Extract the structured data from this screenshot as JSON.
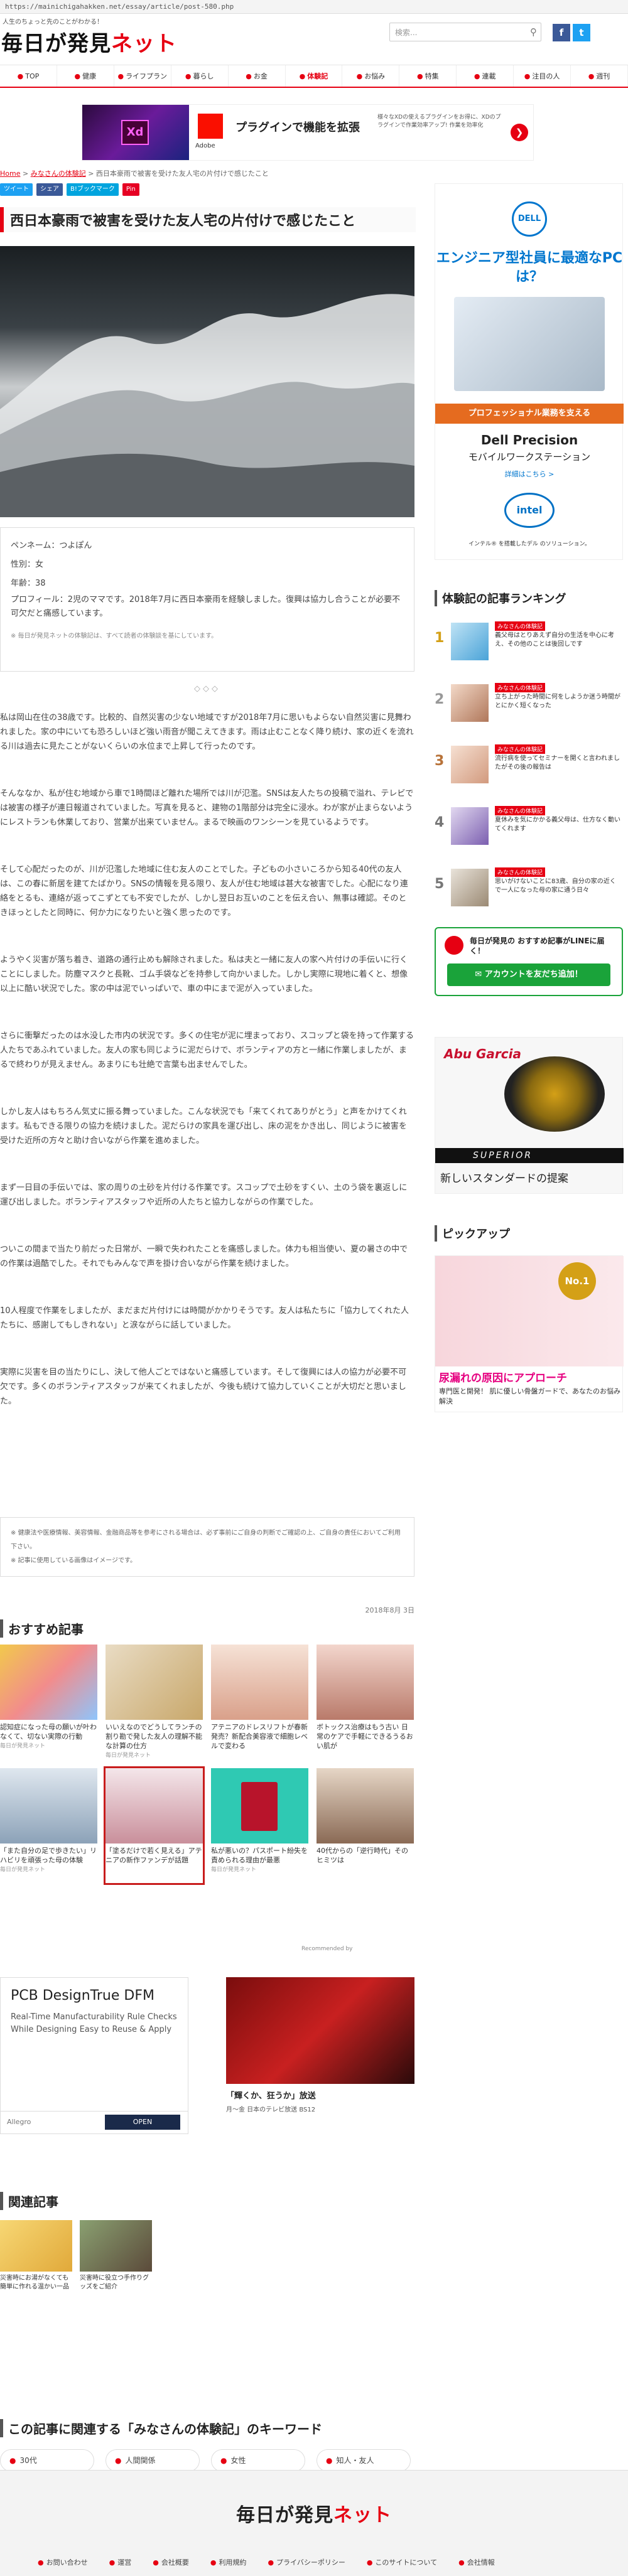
{
  "browser": {
    "url": "https://mainichigahakken.net/essay/article/post-580.php"
  },
  "header": {
    "tagline": "人生のちょっと先のことがわかる！",
    "logo_main": "毎日が発見",
    "logo_accent": "ネット",
    "search_placeholder": "検索...",
    "sns": [
      "f",
      "t"
    ]
  },
  "nav": {
    "items": [
      "TOP",
      "健康",
      "ライフプラン",
      "暮らし",
      "お金",
      "体験記",
      "お悩み",
      "特集",
      "連載",
      "注目の人",
      "週刊"
    ],
    "active_index": 5
  },
  "top_ad": {
    "brand": "Adobe",
    "headline": "プラグインで機能を拡張",
    "desc": "様々なXDの使えるプラグインをお得に、XDのプラグインで作業効率アップ!  作業を効率化",
    "tile": "Xd"
  },
  "breadcrumb": {
    "home": "Home",
    "section": "みなさんの体験記",
    "current": "西日本豪雨で被害を受けた友人宅の片付けで感じたこと"
  },
  "share": {
    "buttons": [
      "ツイート",
      "シェア",
      "B!ブックマーク",
      "Pin"
    ]
  },
  "article": {
    "title": "西日本豪雨で被害を受けた友人宅の片付けで感じたこと",
    "profile": {
      "name": "ペンネーム：つよぽん",
      "gender": "性別：女",
      "age": "年齢：38",
      "bio": "プロフィール：2児のママです。2018年7月に西日本豪雨を経験しました。復興は協力し合うことが必要不可欠だと痛感しています。",
      "note": "※ 毎日が発見ネットの体験記は、すべて読者の体験談を基にしています。"
    },
    "ornament": "◇◇◇",
    "paragraphs": [
      "私は岡山在住の38歳です。比較的、自然災害の少ない地域ですが2018年7月に思いもよらない自然災害に見舞われました。家の中にいても恐ろしいほど強い雨音が聞こえてきます。雨は止むことなく降り続け、家の近くを流れる川は過去に見たことがないくらいの水位まで上昇して行ったのです。",
      "そんななか、私が住む地域から車で1時間ほど離れた場所では川が氾濫。SNSは友人たちの投稿で溢れ、テレビでは被害の様子が連日報道されていました。写真を見ると、建物の1階部分は完全に浸水。わが家が止まらないようにレストランも休業しており、営業が出来ていません。まるで映画のワンシーンを見ているようです。",
      "そして心配だったのが、川が氾濫した地域に住む友人のことでした。子どもの小さいころから知る40代の友人は、この春に新居を建てたばかり。SNSの情報を見る限り、友人が住む地域は甚大な被害でした。心配になり連絡をとるも、連絡が返ってこずとても不安でしたが、しかし翌日お互いのことを伝え合い、無事は確認。そのときほっとしたと同時に、何か力になりたいと強く思ったのです。",
      "ようやく災害が落ち着き、道路の通行止めも解除されました。私は夫と一緒に友人の家へ片付けの手伝いに行くことにしました。防塵マスクと長靴、ゴム手袋などを持参して向かいました。しかし実際に現地に着くと、想像以上に酷い状況でした。家の中は泥でいっぱいで、車の中にまで泥が入っていました。",
      "さらに衝撃だったのは水没した市内の状況です。多くの住宅が泥に埋まっており、スコップと袋を持って作業する人たちであふれていました。友人の家も同じように泥だらけで、ボランティアの方と一緒に作業しましたが、まるで終わりが見えません。あまりにも壮絶で言葉も出ませんでした。",
      "しかし友人はもちろん気丈に振る舞っていました。こんな状況でも「来てくれてありがとう」と声をかけてくれます。私もできる限りの協力を続けました。泥だらけの家具を運び出し、床の泥をかき出し、同じように被害を受けた近所の方々と助け合いながら作業を進めました。",
      "まず一日目の手伝いでは、家の周りの土砂を片付ける作業です。スコップで土砂をすくい、土のう袋を裏返しに運び出しました。ボランティアスタッフや近所の人たちと協力しながらの作業でした。",
      "ついこの間まで当たり前だった日常が、一瞬で失われたことを痛感しました。体力も相当使い、夏の暑さの中での作業は過酷でした。それでもみんなで声を掛け合いながら作業を続けました。",
      "10人程度で作業をしましたが、まだまだ片付けには時間がかかりそうです。友人は私たちに「協力してくれた人たちに、感謝してもしきれない」と涙ながらに話していました。",
      "実際に災害を目の当たりにし、決して他人ごとではないと痛感しています。そして復興には人の協力が必要不可欠です。多くのボランティアスタッフが来てくれましたが、今後も続けて協力していくことが大切だと思いました。"
    ],
    "disclaimer": [
      "※ 健康法や医療情報、美容情報、金融商品等を参考にされる場合は、必ず事前にご自身の判断でご確認の上、ご自身の責任においてご利用下さい。",
      "※ 記事に使用している画像はイメージです。"
    ],
    "date": "2018年8月 3日"
  },
  "recommend": {
    "title": "おすすめ記事",
    "items": [
      {
        "text": "認知症になった母の願いが叶わなくて、切ない実際の行動",
        "src": "毎日が発見ネット"
      },
      {
        "text": "いいえなのでどうしてランチの割り勘で発した友人の理解不能な計算の仕方",
        "src": "毎日が発見ネット"
      },
      {
        "text": "アテニアのドレスリフトが春新発売？新配合美容液で細胞レベルで変わる",
        "src": ""
      },
      {
        "text": "ボトックス治療はもう古い 日常のケアで手軽にできるうるおい肌が",
        "src": ""
      },
      {
        "text": "「また自分の足で歩きたい」リハビリを頑張った母の体験",
        "src": "毎日が発見ネット"
      },
      {
        "text": "「塗るだけで若く見える」アテニアの新作ファンデが話題",
        "src": ""
      },
      {
        "text": "私が悪いの？パスポート紛失を責められる理由が最悪",
        "src": "毎日が発見ネット"
      },
      {
        "text": "40代からの「逆行時代」そのヒミツは",
        "src": ""
      }
    ],
    "powered": "Recommended by"
  },
  "ad_pcb": {
    "headline": "PCB DesignTrue DFM",
    "desc": "Real-Time Manufacturability Rule Checks While Designing Easy to Reuse & Apply",
    "brand": "Allegro",
    "cta": "OPEN"
  },
  "ad_tv": {
    "title": "「輝くか、狂うか」放送",
    "desc": "月〜金 日本のテレビ放送 BS12"
  },
  "related": {
    "title": "関連記事",
    "items": [
      "災害時にお湯がなくても簡単に作れる温かい一品",
      "災害時に役立つ手作りグッズをご紹介"
    ]
  },
  "keywords": {
    "title": "この記事に関連する「みなさんの体験記」のキーワード",
    "items": [
      "30代",
      "人間関係",
      "女性",
      "知人・友人"
    ]
  },
  "footer": {
    "logo_main": "毎日が発見",
    "logo_accent": "ネット",
    "links": [
      "お問い合わせ",
      "運営",
      "会社概要",
      "利用規約",
      "プライバシーポリシー",
      "このサイトについて",
      "会社情報"
    ]
  },
  "sidebar": {
    "dell_ad": {
      "brand": "DELL",
      "headline": "エンジニア型社員に最適なPCは？",
      "banner": "プロフェッショナル業務を支える",
      "product": "Dell Precision",
      "sub": "モバイルワークステーション",
      "link": "詳細はこちら >",
      "footer": "インテル® を搭載したデル のソリューション。",
      "intel": "intel"
    },
    "ranking_title": "体験記の記事ランキング",
    "ranking": [
      {
        "badge": "みなさんの体験記",
        "text": "義父母はとりあえず自分の生活を中心に考え、その他のことは後回しです"
      },
      {
        "badge": "みなさんの体験記",
        "text": "立ち上がった時間に何をしようか迷う時間がとにかく短くなった"
      },
      {
        "badge": "みなさんの体験記",
        "text": "流行病を使ってセミナーを開くと言われましたがその後の報告は"
      },
      {
        "badge": "みなさんの体験記",
        "text": "夏休みを気にかかる義父母は、仕方なく動いてくれます"
      },
      {
        "badge": "みなさんの体験記",
        "text": "思いがけないことに83歳、自分の家の近くで一人になった母の家に通う日々"
      }
    ],
    "line": {
      "title": "毎日が発見の おすすめ記事がLINEに届く！",
      "button": "アカウントを友だち追加！"
    },
    "abu_ad": {
      "brand": "Abu Garcia",
      "product": "SUPERIOR",
      "tagline": "新しいスタンダードの提案"
    },
    "pickup_title": "ピックアップ",
    "health_ad": {
      "headline": "尿漏れの原因にアプローチ",
      "desc": "専門医と開発！ 肌に優しい骨盤ガードで、あなたのお悩み解決",
      "badge": "No.1"
    }
  }
}
